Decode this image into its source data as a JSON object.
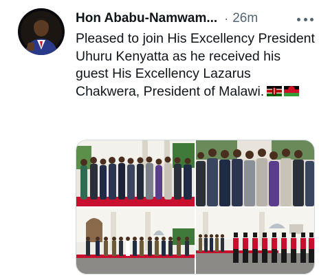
{
  "tweet": {
    "author_name": "Hon Ababu-Namwam...",
    "separator": "·",
    "timestamp": "26m",
    "text": "Pleased to join His Excellency President Uhuru Kenyatta as he received his guest His Excellency Lazarus Chakwera, President of Malawi.",
    "emojis": [
      "kenya-flag",
      "malawi-flag"
    ]
  },
  "media": {
    "photo_count": 4
  },
  "colors": {
    "text_primary": "#0f1419",
    "text_secondary": "#536471",
    "border": "#cfd9de",
    "red_carpet": "#c8102e"
  }
}
